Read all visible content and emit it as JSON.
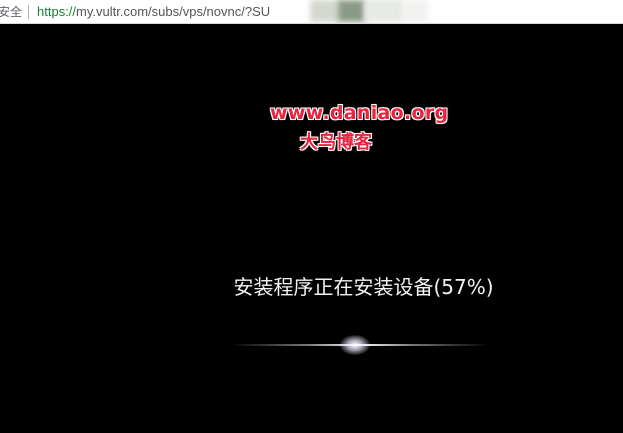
{
  "browser": {
    "security_label": "安全",
    "url_scheme": "https://",
    "url_rest": "my.vultr.com/subs/vps/novnc/?SU"
  },
  "console": {
    "watermark_url": "www.daniao.org",
    "watermark_name": "大鸟博客",
    "status_text": "安装程序正在安装设备(57%)",
    "progress_percent": 57
  }
}
